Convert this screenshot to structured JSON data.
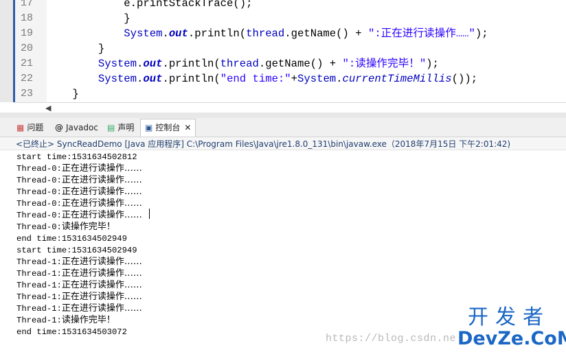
{
  "editor": {
    "lines": [
      {
        "no": "17",
        "code": "            e.printStackTrace();"
      },
      {
        "no": "18",
        "code": "            }"
      },
      {
        "no": "19",
        "parts": [
          "System",
          "out",
          "println",
          "thread",
          "getName",
          ":正在进行读操作……"
        ]
      },
      {
        "no": "20",
        "code": "        }"
      },
      {
        "no": "21",
        "parts": [
          "System",
          "out",
          "println",
          "thread",
          "getName",
          ":读操作完毕！"
        ]
      },
      {
        "no": "22",
        "parts": [
          "System",
          "out",
          "println",
          "end time:",
          "System",
          "currentTimeMillis"
        ]
      },
      {
        "no": "23",
        "code": "    }"
      }
    ]
  },
  "tabs": [
    {
      "label": "问题",
      "icon": "problems-icon"
    },
    {
      "label": "Javadoc",
      "icon": "javadoc-icon"
    },
    {
      "label": "声明",
      "icon": "declaration-icon"
    },
    {
      "label": "控制台",
      "icon": "console-icon",
      "active": true
    }
  ],
  "console": {
    "status": "<已终止> SyncReadDemo [Java 应用程序] C:\\Program Files\\Java\\jre1.8.0_131\\bin\\javaw.exe（2018年7月15日 下午2:01:42)",
    "lines": [
      {
        "prefix": "start time:1531634502812",
        "cn": ""
      },
      {
        "prefix": "Thread-0:",
        "cn": "正在进行读操作……"
      },
      {
        "prefix": "Thread-0:",
        "cn": "正在进行读操作……"
      },
      {
        "prefix": "Thread-0:",
        "cn": "正在进行读操作……"
      },
      {
        "prefix": "Thread-0:",
        "cn": "正在进行读操作……"
      },
      {
        "prefix": "Thread-0:",
        "cn": "正在进行读操作……"
      },
      {
        "prefix": "Thread-0:",
        "cn": "读操作完毕！"
      },
      {
        "prefix": "end time:1531634502949",
        "cn": ""
      },
      {
        "prefix": "start time:1531634502949",
        "cn": ""
      },
      {
        "prefix": "Thread-1:",
        "cn": "正在进行读操作……"
      },
      {
        "prefix": "Thread-1:",
        "cn": "正在进行读操作……"
      },
      {
        "prefix": "Thread-1:",
        "cn": "正在进行读操作……"
      },
      {
        "prefix": "Thread-1:",
        "cn": "正在进行读操作……"
      },
      {
        "prefix": "Thread-1:",
        "cn": "正在进行读操作……"
      },
      {
        "prefix": "Thread-1:",
        "cn": "读操作完毕！"
      },
      {
        "prefix": "end time:1531634503072",
        "cn": ""
      }
    ]
  },
  "watermark": {
    "url": "https://blog.csdn.ne",
    "logo_cn": "开发者",
    "logo_en": "DevZe.CoM"
  }
}
